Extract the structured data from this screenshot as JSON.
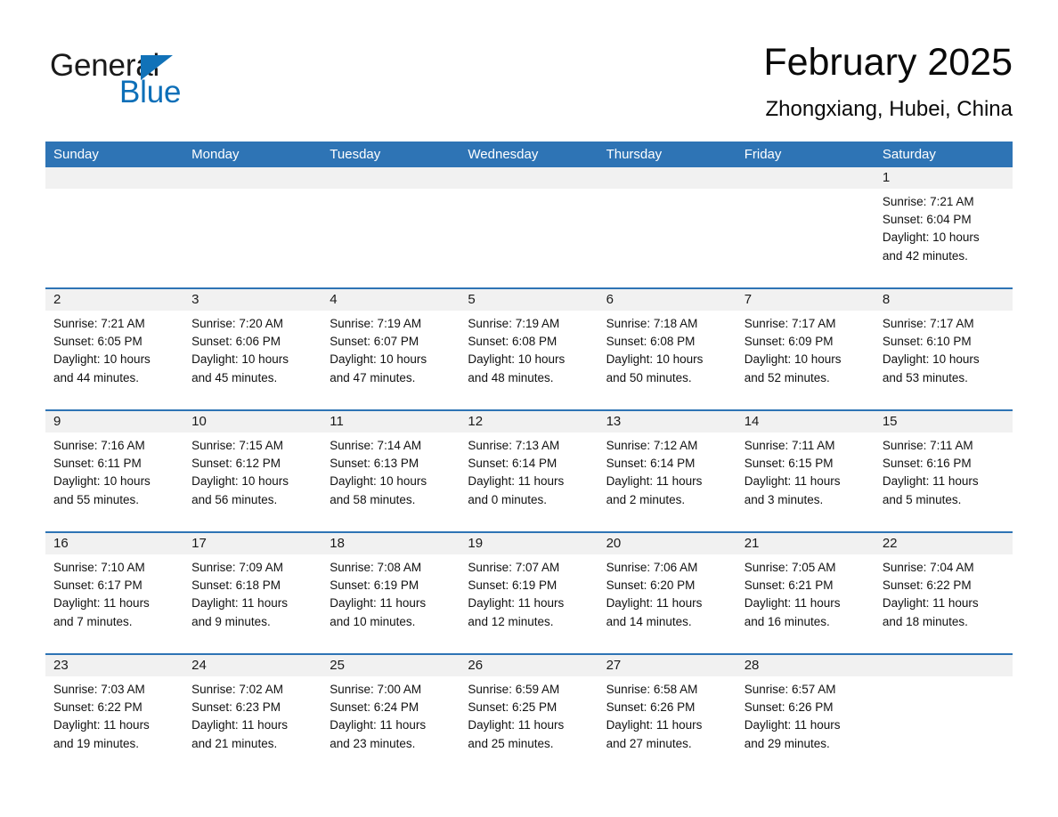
{
  "brand": {
    "name_part1": "General",
    "name_part2": "Blue",
    "triangle_color": "#1172b8",
    "text_color": "#1a1a1a"
  },
  "header": {
    "title": "February 2025",
    "subtitle": "Zhongxiang, Hubei, China"
  },
  "theme": {
    "header_blue": "#2e74b5",
    "day_band_gray": "#f1f1f1",
    "page_background": "#ffffff"
  },
  "weekdays": [
    "Sunday",
    "Monday",
    "Tuesday",
    "Wednesday",
    "Thursday",
    "Friday",
    "Saturday"
  ],
  "weeks": [
    [
      {
        "day": "",
        "sunrise": "",
        "sunset": "",
        "daylight_1": "",
        "daylight_2": ""
      },
      {
        "day": "",
        "sunrise": "",
        "sunset": "",
        "daylight_1": "",
        "daylight_2": ""
      },
      {
        "day": "",
        "sunrise": "",
        "sunset": "",
        "daylight_1": "",
        "daylight_2": ""
      },
      {
        "day": "",
        "sunrise": "",
        "sunset": "",
        "daylight_1": "",
        "daylight_2": ""
      },
      {
        "day": "",
        "sunrise": "",
        "sunset": "",
        "daylight_1": "",
        "daylight_2": ""
      },
      {
        "day": "",
        "sunrise": "",
        "sunset": "",
        "daylight_1": "",
        "daylight_2": ""
      },
      {
        "day": "1",
        "sunrise": "Sunrise: 7:21 AM",
        "sunset": "Sunset: 6:04 PM",
        "daylight_1": "Daylight: 10 hours",
        "daylight_2": "and 42 minutes."
      }
    ],
    [
      {
        "day": "2",
        "sunrise": "Sunrise: 7:21 AM",
        "sunset": "Sunset: 6:05 PM",
        "daylight_1": "Daylight: 10 hours",
        "daylight_2": "and 44 minutes."
      },
      {
        "day": "3",
        "sunrise": "Sunrise: 7:20 AM",
        "sunset": "Sunset: 6:06 PM",
        "daylight_1": "Daylight: 10 hours",
        "daylight_2": "and 45 minutes."
      },
      {
        "day": "4",
        "sunrise": "Sunrise: 7:19 AM",
        "sunset": "Sunset: 6:07 PM",
        "daylight_1": "Daylight: 10 hours",
        "daylight_2": "and 47 minutes."
      },
      {
        "day": "5",
        "sunrise": "Sunrise: 7:19 AM",
        "sunset": "Sunset: 6:08 PM",
        "daylight_1": "Daylight: 10 hours",
        "daylight_2": "and 48 minutes."
      },
      {
        "day": "6",
        "sunrise": "Sunrise: 7:18 AM",
        "sunset": "Sunset: 6:08 PM",
        "daylight_1": "Daylight: 10 hours",
        "daylight_2": "and 50 minutes."
      },
      {
        "day": "7",
        "sunrise": "Sunrise: 7:17 AM",
        "sunset": "Sunset: 6:09 PM",
        "daylight_1": "Daylight: 10 hours",
        "daylight_2": "and 52 minutes."
      },
      {
        "day": "8",
        "sunrise": "Sunrise: 7:17 AM",
        "sunset": "Sunset: 6:10 PM",
        "daylight_1": "Daylight: 10 hours",
        "daylight_2": "and 53 minutes."
      }
    ],
    [
      {
        "day": "9",
        "sunrise": "Sunrise: 7:16 AM",
        "sunset": "Sunset: 6:11 PM",
        "daylight_1": "Daylight: 10 hours",
        "daylight_2": "and 55 minutes."
      },
      {
        "day": "10",
        "sunrise": "Sunrise: 7:15 AM",
        "sunset": "Sunset: 6:12 PM",
        "daylight_1": "Daylight: 10 hours",
        "daylight_2": "and 56 minutes."
      },
      {
        "day": "11",
        "sunrise": "Sunrise: 7:14 AM",
        "sunset": "Sunset: 6:13 PM",
        "daylight_1": "Daylight: 10 hours",
        "daylight_2": "and 58 minutes."
      },
      {
        "day": "12",
        "sunrise": "Sunrise: 7:13 AM",
        "sunset": "Sunset: 6:14 PM",
        "daylight_1": "Daylight: 11 hours",
        "daylight_2": "and 0 minutes."
      },
      {
        "day": "13",
        "sunrise": "Sunrise: 7:12 AM",
        "sunset": "Sunset: 6:14 PM",
        "daylight_1": "Daylight: 11 hours",
        "daylight_2": "and 2 minutes."
      },
      {
        "day": "14",
        "sunrise": "Sunrise: 7:11 AM",
        "sunset": "Sunset: 6:15 PM",
        "daylight_1": "Daylight: 11 hours",
        "daylight_2": "and 3 minutes."
      },
      {
        "day": "15",
        "sunrise": "Sunrise: 7:11 AM",
        "sunset": "Sunset: 6:16 PM",
        "daylight_1": "Daylight: 11 hours",
        "daylight_2": "and 5 minutes."
      }
    ],
    [
      {
        "day": "16",
        "sunrise": "Sunrise: 7:10 AM",
        "sunset": "Sunset: 6:17 PM",
        "daylight_1": "Daylight: 11 hours",
        "daylight_2": "and 7 minutes."
      },
      {
        "day": "17",
        "sunrise": "Sunrise: 7:09 AM",
        "sunset": "Sunset: 6:18 PM",
        "daylight_1": "Daylight: 11 hours",
        "daylight_2": "and 9 minutes."
      },
      {
        "day": "18",
        "sunrise": "Sunrise: 7:08 AM",
        "sunset": "Sunset: 6:19 PM",
        "daylight_1": "Daylight: 11 hours",
        "daylight_2": "and 10 minutes."
      },
      {
        "day": "19",
        "sunrise": "Sunrise: 7:07 AM",
        "sunset": "Sunset: 6:19 PM",
        "daylight_1": "Daylight: 11 hours",
        "daylight_2": "and 12 minutes."
      },
      {
        "day": "20",
        "sunrise": "Sunrise: 7:06 AM",
        "sunset": "Sunset: 6:20 PM",
        "daylight_1": "Daylight: 11 hours",
        "daylight_2": "and 14 minutes."
      },
      {
        "day": "21",
        "sunrise": "Sunrise: 7:05 AM",
        "sunset": "Sunset: 6:21 PM",
        "daylight_1": "Daylight: 11 hours",
        "daylight_2": "and 16 minutes."
      },
      {
        "day": "22",
        "sunrise": "Sunrise: 7:04 AM",
        "sunset": "Sunset: 6:22 PM",
        "daylight_1": "Daylight: 11 hours",
        "daylight_2": "and 18 minutes."
      }
    ],
    [
      {
        "day": "23",
        "sunrise": "Sunrise: 7:03 AM",
        "sunset": "Sunset: 6:22 PM",
        "daylight_1": "Daylight: 11 hours",
        "daylight_2": "and 19 minutes."
      },
      {
        "day": "24",
        "sunrise": "Sunrise: 7:02 AM",
        "sunset": "Sunset: 6:23 PM",
        "daylight_1": "Daylight: 11 hours",
        "daylight_2": "and 21 minutes."
      },
      {
        "day": "25",
        "sunrise": "Sunrise: 7:00 AM",
        "sunset": "Sunset: 6:24 PM",
        "daylight_1": "Daylight: 11 hours",
        "daylight_2": "and 23 minutes."
      },
      {
        "day": "26",
        "sunrise": "Sunrise: 6:59 AM",
        "sunset": "Sunset: 6:25 PM",
        "daylight_1": "Daylight: 11 hours",
        "daylight_2": "and 25 minutes."
      },
      {
        "day": "27",
        "sunrise": "Sunrise: 6:58 AM",
        "sunset": "Sunset: 6:26 PM",
        "daylight_1": "Daylight: 11 hours",
        "daylight_2": "and 27 minutes."
      },
      {
        "day": "28",
        "sunrise": "Sunrise: 6:57 AM",
        "sunset": "Sunset: 6:26 PM",
        "daylight_1": "Daylight: 11 hours",
        "daylight_2": "and 29 minutes."
      },
      {
        "day": "",
        "sunrise": "",
        "sunset": "",
        "daylight_1": "",
        "daylight_2": ""
      }
    ]
  ]
}
